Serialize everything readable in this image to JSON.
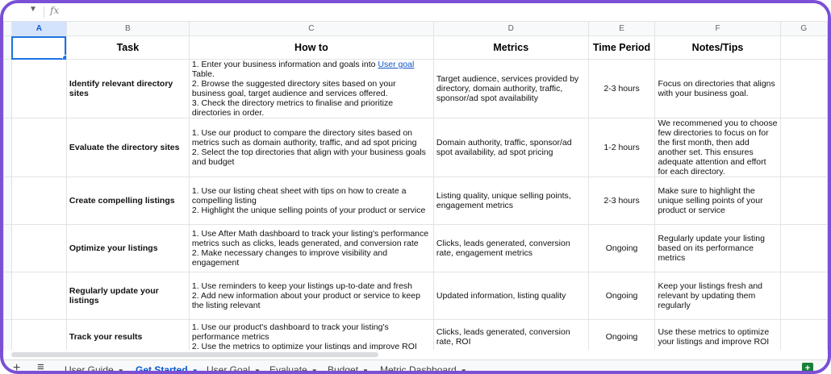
{
  "formula_bar": {
    "fx_label": "fx",
    "value": ""
  },
  "columns": [
    "A",
    "B",
    "C",
    "D",
    "E",
    "F",
    "G"
  ],
  "selected_cell": "A",
  "headers": {
    "task": "Task",
    "howto": "How to",
    "metrics": "Metrics",
    "period": "Time Period",
    "notes": "Notes/Tips"
  },
  "rows": [
    {
      "task": "Identify relevant directory sites",
      "howto_pre": "1. Enter your business information and goals into ",
      "howto_link": "User goal ",
      "howto_post": "Table.\n2. Browse the suggested directory sites based on your business goal, target audience and services offered.\n3. Check the directory metrics to finalise and prioritize directories in order.",
      "metrics": "Target audience, services provided by directory, domain authority, traffic, sponsor/ad spot availability",
      "period": "2-3 hours",
      "notes": "Focus on directories that aligns with your business goal."
    },
    {
      "task": "Evaluate the directory sites",
      "howto": "1. Use our product to compare the directory sites based on metrics such as domain authority, traffic, and ad spot pricing\n2. Select the top directories that align with your business goals and budget",
      "metrics": "Domain authority, traffic, sponsor/ad spot availability, ad spot pricing",
      "period": "1-2 hours",
      "notes": "We recommened you to choose few directories to focus on for the first month, then add another set. This ensures adequate attention and effort for each directory."
    },
    {
      "task": "Create compelling listings",
      "howto": "1. Use our listing cheat sheet with tips on how to create a compelling listing\n2. Highlight the unique selling points of your product or service",
      "metrics": "Listing quality, unique selling points, engagement metrics",
      "period": "2-3 hours",
      "notes": "Make sure to highlight the unique selling points of your product or service"
    },
    {
      "task": "Optimize your listings",
      "howto": "1. Use After Math dashboard to track your listing's performance metrics such as clicks, leads generated, and conversion rate\n2. Make necessary changes to improve visibility and engagement",
      "metrics": "Clicks, leads generated, conversion rate, engagement metrics",
      "period": "Ongoing",
      "notes": "Regularly update your listing based on its performance metrics"
    },
    {
      "task": "Regularly update your listings",
      "howto": "1. Use reminders to keep your listings up-to-date and fresh\n2. Add new information about your product or service to keep the listing relevant",
      "metrics": "Updated information, listing quality",
      "period": "Ongoing",
      "notes": "Keep your listings fresh and relevant by updating them regularly"
    },
    {
      "task": "Track your results",
      "howto": "1. Use our product's dashboard to track your listing's performance metrics\n2. Use the metrics to optimize your listings and improve ROI",
      "metrics": "Clicks, leads generated, conversion rate, ROI",
      "period": "Ongoing",
      "notes": "Use these metrics to optimize your listings and improve ROI"
    }
  ],
  "tabs": [
    {
      "label": "User Guide",
      "active": false
    },
    {
      "label": "Get Started",
      "active": true
    },
    {
      "label": "User Goal",
      "active": false
    },
    {
      "label": "Evaluate",
      "active": false
    },
    {
      "label": "Budget",
      "active": false
    },
    {
      "label": "Metric Dashboard",
      "active": false
    }
  ],
  "icons": {
    "add_sheet": "plus-icon",
    "all_sheets": "menu-icon",
    "explore": "explore-icon"
  },
  "colors": {
    "frame": "#7b4fd6",
    "selection": "#1a73e8",
    "active_tab": "#0b57d0",
    "explore": "#188038"
  }
}
